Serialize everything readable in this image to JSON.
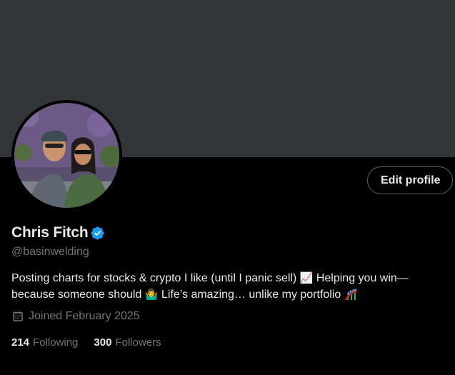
{
  "profile": {
    "name": "Chris Fitch",
    "handle": "@basinwelding",
    "bio": {
      "part1": "Posting charts for stocks & crypto I like (until I panic sell) ",
      "emoji1": "📈",
      "part2": " Helping you win—because someone should ",
      "emoji2": "🤷‍♂️",
      "part3": " Life’s amazing… unlike my portfolio ",
      "emoji3": "🎢"
    },
    "joined": "Joined February 2025",
    "following_count": "214",
    "following_label": "Following",
    "followers_count": "300",
    "followers_label": "Followers"
  },
  "actions": {
    "edit_profile_label": "Edit profile"
  },
  "colors": {
    "background": "#000000",
    "banner": "#333639",
    "verified": "#1d9bf0",
    "muted_text": "#71767b",
    "primary_text": "#e7e9ea"
  },
  "icons": {
    "verified": "verified-badge-icon",
    "calendar": "calendar-icon"
  }
}
